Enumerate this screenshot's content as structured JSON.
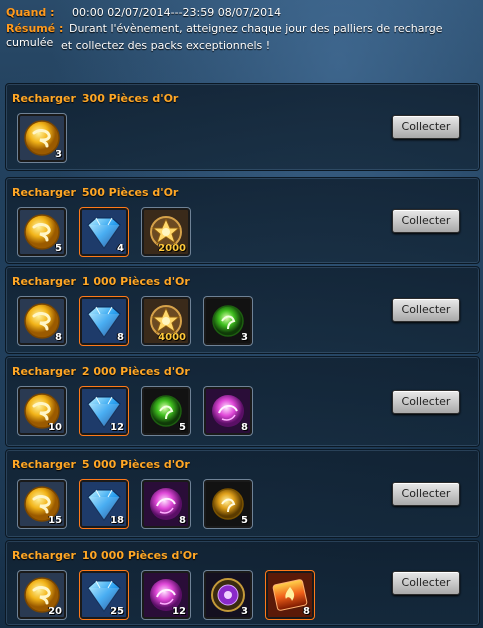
{
  "header": {
    "when_label": "Quand :",
    "when_value": "00:00 02/07/2014---23:59 08/07/2014",
    "summary_label": "Résumé :",
    "summary_line1": "Durant l'évènement, atteignez chaque jour des palliers de recharge cumulée",
    "summary_line2": "et collectez des packs exceptionnels !"
  },
  "tiers": [
    {
      "title": "Recharger",
      "amount": "300 Pièces d'Or",
      "button": "Collecter",
      "items": [
        {
          "icon": "gold-coin-icon",
          "qty": "3"
        }
      ]
    },
    {
      "title": "Recharger",
      "amount": "500 Pièces d'Or",
      "button": "Collecter",
      "items": [
        {
          "icon": "gold-coin-icon",
          "qty": "5"
        },
        {
          "icon": "blue-gem-icon",
          "qty": "4"
        },
        {
          "icon": "star-badge-icon",
          "qty": "2000"
        }
      ]
    },
    {
      "title": "Recharger",
      "amount": "1 000 Pièces d'Or",
      "button": "Collecter",
      "items": [
        {
          "icon": "gold-coin-icon",
          "qty": "8"
        },
        {
          "icon": "blue-gem-icon",
          "qty": "8"
        },
        {
          "icon": "star-badge-icon",
          "qty": "4000"
        },
        {
          "icon": "green-orb-icon",
          "qty": "3"
        }
      ]
    },
    {
      "title": "Recharger",
      "amount": "2 000 Pièces d'Or",
      "button": "Collecter",
      "items": [
        {
          "icon": "gold-coin-icon",
          "qty": "10"
        },
        {
          "icon": "blue-gem-icon",
          "qty": "12"
        },
        {
          "icon": "green-orb-icon",
          "qty": "5"
        },
        {
          "icon": "pink-orb-icon",
          "qty": "8"
        }
      ]
    },
    {
      "title": "Recharger",
      "amount": "5 000 Pièces d'Or",
      "button": "Collecter",
      "items": [
        {
          "icon": "gold-coin-icon",
          "qty": "15"
        },
        {
          "icon": "blue-gem-icon",
          "qty": "18"
        },
        {
          "icon": "pink-orb-icon",
          "qty": "8"
        },
        {
          "icon": "gold-orb-icon",
          "qty": "5"
        }
      ]
    },
    {
      "title": "Recharger",
      "amount": "10 000 Pièces d'Or",
      "button": "Collecter",
      "items": [
        {
          "icon": "gold-coin-icon",
          "qty": "20"
        },
        {
          "icon": "blue-gem-icon",
          "qty": "25"
        },
        {
          "icon": "pink-orb-icon",
          "qty": "12"
        },
        {
          "icon": "purple-medallion-icon",
          "qty": "3"
        },
        {
          "icon": "fire-scroll-icon",
          "qty": "8"
        }
      ]
    }
  ]
}
